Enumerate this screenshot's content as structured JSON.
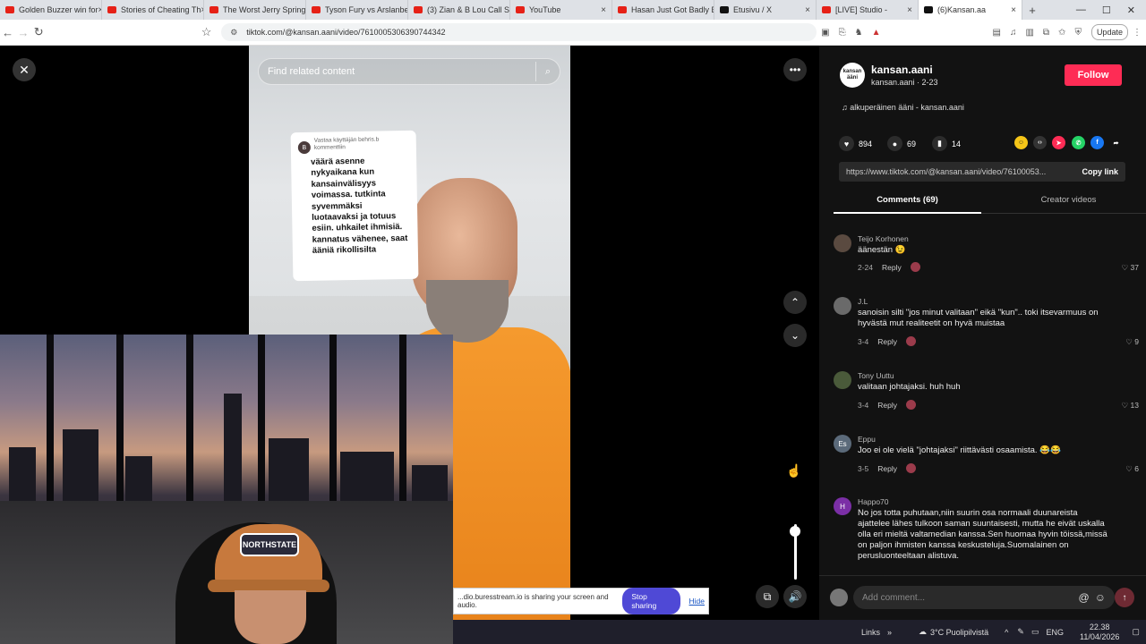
{
  "browser": {
    "tabs": [
      {
        "title": "Golden Buzzer win for",
        "icon": "youtube-icon"
      },
      {
        "title": "Stories of Cheating Th",
        "icon": "youtube-icon"
      },
      {
        "title": "The Worst Jerry Spring",
        "icon": "youtube-icon"
      },
      {
        "title": "Tyson Fury vs Arslanbe",
        "icon": "youtube-icon"
      },
      {
        "title": "(3) Zian & B Lou Call S",
        "icon": "youtube-icon"
      },
      {
        "title": "YouTube",
        "icon": "youtube-icon"
      },
      {
        "title": "Hasan Just Got Badly E",
        "icon": "youtube-icon"
      },
      {
        "title": "Etusivu / X",
        "icon": "x-icon"
      },
      {
        "title": "[LIVE] Studio -",
        "icon": "studio-icon"
      },
      {
        "title": "(6)Kansan.aa",
        "icon": "tiktok-icon"
      }
    ],
    "url": "tiktok.com/@kansan.aani/video/7610005306390744342",
    "update_label": "Update"
  },
  "video": {
    "search_placeholder": "Find related content",
    "reply_header": "Vastaa käyttäjän behris.b kommenttiin",
    "reply_avatar": "B",
    "reply_text": "väärä asenne nykyaikana kun kansainvälisyys voimassa. tutkinta syvemmäksi luotaavaksi ja totuus esiin. uhkailet ihmisiä. kannatus vähenee, saat ääniä rikollisilta"
  },
  "webcam": {
    "cap_text": "NORTHSTATE"
  },
  "sharebar": {
    "text": "...dio.buresstream.io is sharing your screen and audio.",
    "stop_label": "Stop sharing",
    "hide_label": "Hide"
  },
  "profile": {
    "avatar_text": "kansan ääni",
    "username": "kansan.aani",
    "subtitle": "kansan.aani · 2-23",
    "follow_label": "Follow",
    "music": "alkuperäinen ääni - kansan.aani"
  },
  "stats": {
    "likes": "894",
    "comments": "69",
    "saves": "14"
  },
  "link": {
    "url": "https://www.tiktok.com/@kansan.aani/video/76100053...",
    "copy_label": "Copy link"
  },
  "tabs": {
    "comments": "Comments (69)",
    "creator": "Creator videos"
  },
  "comments": [
    {
      "name": "Teijo Korhonen",
      "text": "äänestän 😉",
      "date": "2-24",
      "likes": "37",
      "avatar": "",
      "avatar_color": "#5a4a40"
    },
    {
      "name": "J.L",
      "text": "sanoisin silti \"jos minut valitaan\" eikä \"kun\".. toki itsevarmuus on hyvästä mut realiteetit on hyvä muistaa",
      "date": "3-4",
      "likes": "9",
      "avatar": "",
      "avatar_color": "#6a6a6a"
    },
    {
      "name": "Tony Uuttu",
      "text": "valitaan johtajaksi. huh huh",
      "date": "3-4",
      "likes": "13",
      "avatar": "",
      "avatar_color": "#4a5a3a"
    },
    {
      "name": "Eppu",
      "text": "Joo ei ole vielä \"johtajaksi\" riittävästi osaamista. 😂😂",
      "date": "3-5",
      "likes": "6",
      "avatar": "Es",
      "avatar_color": "#5b6a7a"
    },
    {
      "name": "Happo70",
      "text": "No jos totta puhutaan,niin suurin osa normaali duunareista ajattelee lähes tulkoon saman suuntaisesti, mutta he eivät uskalla olla eri mieltä valtamedian kanssa.Sen huomaa hyvin töissä,missä on paljon ihmisten kanssa keskusteluja.Suomalainen on perusluonteeltaan alistuva.",
      "date": "",
      "likes": "",
      "avatar": "H",
      "avatar_color": "#7b2fa6"
    }
  ],
  "reply_label": "Reply",
  "add_comment_placeholder": "Add comment...",
  "taskbar": {
    "links": "Links",
    "weather": "3°C  Puolipilvistä",
    "lang": "ENG",
    "time": "22.38",
    "date": "11/04/2026"
  }
}
